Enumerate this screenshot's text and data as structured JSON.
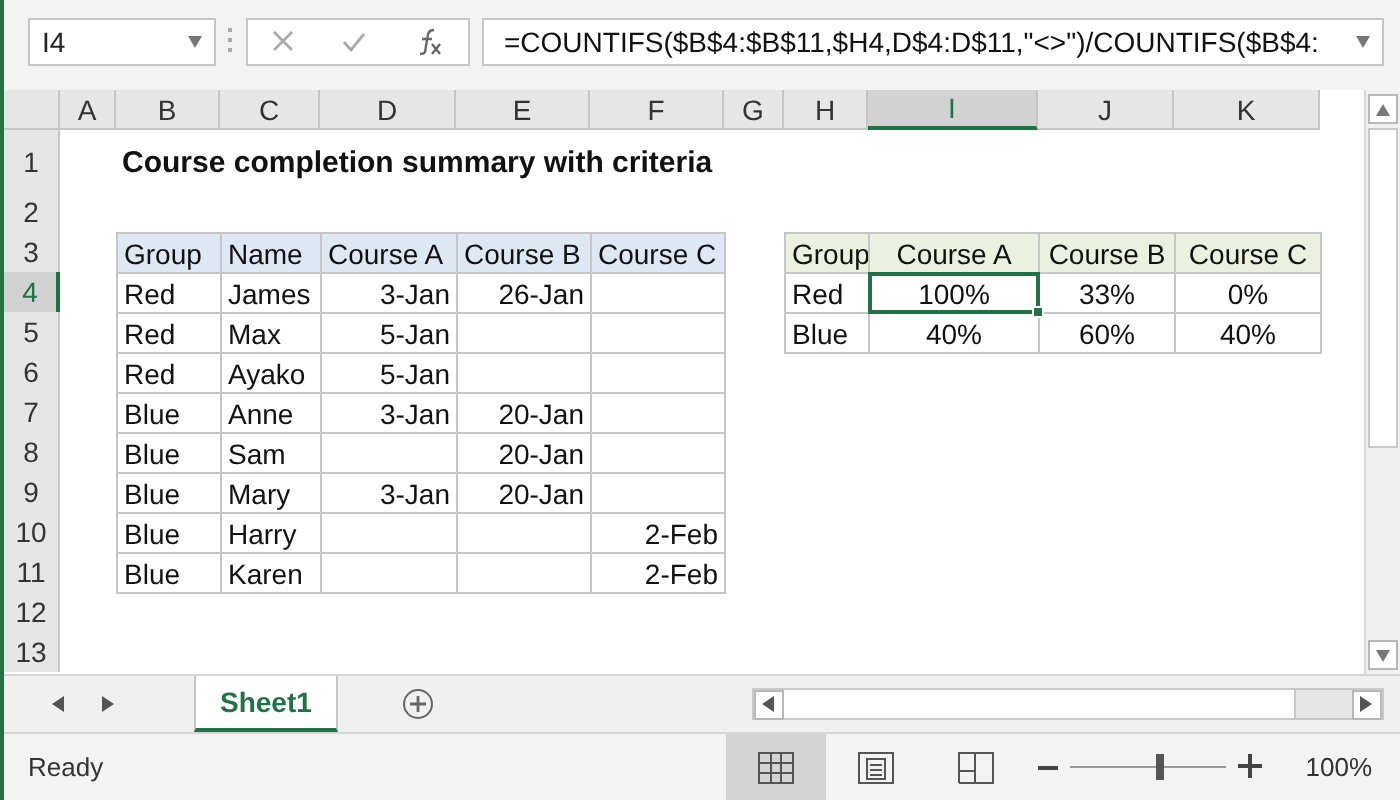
{
  "name_box": "I4",
  "formula": "=COUNTIFS($B$4:$B$11,$H4,D$4:D$11,\"<>\")/COUNTIFS($B$4:",
  "sheet": {
    "columns": [
      {
        "letter": "A",
        "selected": false
      },
      {
        "letter": "B",
        "selected": false
      },
      {
        "letter": "C",
        "selected": false
      },
      {
        "letter": "D",
        "selected": false
      },
      {
        "letter": "E",
        "selected": false
      },
      {
        "letter": "F",
        "selected": false
      },
      {
        "letter": "G",
        "selected": false
      },
      {
        "letter": "H",
        "selected": false
      },
      {
        "letter": "I",
        "selected": true
      },
      {
        "letter": "J",
        "selected": false
      },
      {
        "letter": "K",
        "selected": false
      }
    ],
    "rows": [
      {
        "number": "1",
        "selected": false,
        "cells": [
          {
            "kind": "blank"
          },
          {
            "kind": "title",
            "text": "Course completion summary with criteria"
          }
        ]
      },
      {
        "number": "2",
        "selected": false,
        "cells": []
      },
      {
        "number": "3",
        "selected": false,
        "cells": [
          {
            "kind": "blank"
          },
          {
            "kind": "head",
            "text": "Group"
          },
          {
            "kind": "head",
            "text": "Name"
          },
          {
            "kind": "head",
            "text": "Course A"
          },
          {
            "kind": "head",
            "text": "Course B"
          },
          {
            "kind": "head",
            "text": "Course C"
          },
          {
            "kind": "blank"
          },
          {
            "kind": "head2",
            "text": "Group"
          },
          {
            "kind": "head2c",
            "text": "Course A"
          },
          {
            "kind": "head2c",
            "text": "Course B"
          },
          {
            "kind": "head2c",
            "text": "Course C"
          }
        ]
      },
      {
        "number": "4",
        "selected": true,
        "cells": [
          {
            "kind": "blank"
          },
          {
            "kind": "text",
            "text": "Red"
          },
          {
            "kind": "text",
            "text": "James"
          },
          {
            "kind": "date",
            "text": "3-Jan"
          },
          {
            "kind": "date",
            "text": "26-Jan"
          },
          {
            "kind": "date"
          },
          {
            "kind": "blank"
          },
          {
            "kind": "text",
            "text": "Red"
          },
          {
            "kind": "pct",
            "text": "100%"
          },
          {
            "kind": "pct",
            "text": "33%"
          },
          {
            "kind": "pct",
            "text": "0%"
          }
        ]
      },
      {
        "number": "5",
        "selected": false,
        "cells": [
          {
            "kind": "blank"
          },
          {
            "kind": "text",
            "text": "Red"
          },
          {
            "kind": "text",
            "text": "Max"
          },
          {
            "kind": "date",
            "text": "5-Jan"
          },
          {
            "kind": "date"
          },
          {
            "kind": "date"
          },
          {
            "kind": "blank"
          },
          {
            "kind": "text",
            "text": "Blue"
          },
          {
            "kind": "pct",
            "text": "40%"
          },
          {
            "kind": "pct",
            "text": "60%"
          },
          {
            "kind": "pct",
            "text": "40%"
          }
        ]
      },
      {
        "number": "6",
        "selected": false,
        "cells": [
          {
            "kind": "blank"
          },
          {
            "kind": "text",
            "text": "Red"
          },
          {
            "kind": "text",
            "text": "Ayako"
          },
          {
            "kind": "date",
            "text": "5-Jan"
          },
          {
            "kind": "date"
          },
          {
            "kind": "date"
          }
        ]
      },
      {
        "number": "7",
        "selected": false,
        "cells": [
          {
            "kind": "blank"
          },
          {
            "kind": "text",
            "text": "Blue"
          },
          {
            "kind": "text",
            "text": "Anne"
          },
          {
            "kind": "date",
            "text": "3-Jan"
          },
          {
            "kind": "date",
            "text": "20-Jan"
          },
          {
            "kind": "date"
          }
        ]
      },
      {
        "number": "8",
        "selected": false,
        "cells": [
          {
            "kind": "blank"
          },
          {
            "kind": "text",
            "text": "Blue"
          },
          {
            "kind": "text",
            "text": "Sam"
          },
          {
            "kind": "date"
          },
          {
            "kind": "date",
            "text": "20-Jan"
          },
          {
            "kind": "date"
          }
        ]
      },
      {
        "number": "9",
        "selected": false,
        "cells": [
          {
            "kind": "blank"
          },
          {
            "kind": "text",
            "text": "Blue"
          },
          {
            "kind": "text",
            "text": "Mary"
          },
          {
            "kind": "date",
            "text": "3-Jan"
          },
          {
            "kind": "date",
            "text": "20-Jan"
          },
          {
            "kind": "date"
          }
        ]
      },
      {
        "number": "10",
        "selected": false,
        "cells": [
          {
            "kind": "blank"
          },
          {
            "kind": "text",
            "text": "Blue"
          },
          {
            "kind": "text",
            "text": "Harry"
          },
          {
            "kind": "date"
          },
          {
            "kind": "date"
          },
          {
            "kind": "date",
            "text": "2-Feb"
          }
        ]
      },
      {
        "number": "11",
        "selected": false,
        "cells": [
          {
            "kind": "blank"
          },
          {
            "kind": "text",
            "text": "Blue"
          },
          {
            "kind": "text",
            "text": "Karen"
          },
          {
            "kind": "date"
          },
          {
            "kind": "date"
          },
          {
            "kind": "date",
            "text": "2-Feb"
          }
        ]
      },
      {
        "number": "12",
        "selected": false,
        "cells": []
      },
      {
        "number": "13",
        "selected": false,
        "cells": []
      }
    ]
  },
  "sheet_tabs": [
    {
      "label": "Sheet1",
      "selected": true
    }
  ],
  "status_bar": {
    "status": "Ready",
    "views": [
      {
        "kind": "normal",
        "selected": true
      },
      {
        "kind": "page_layout",
        "selected": false
      },
      {
        "kind": "page_break",
        "selected": false
      }
    ],
    "zoom": {
      "level": 0.58,
      "reading": "100%"
    }
  }
}
